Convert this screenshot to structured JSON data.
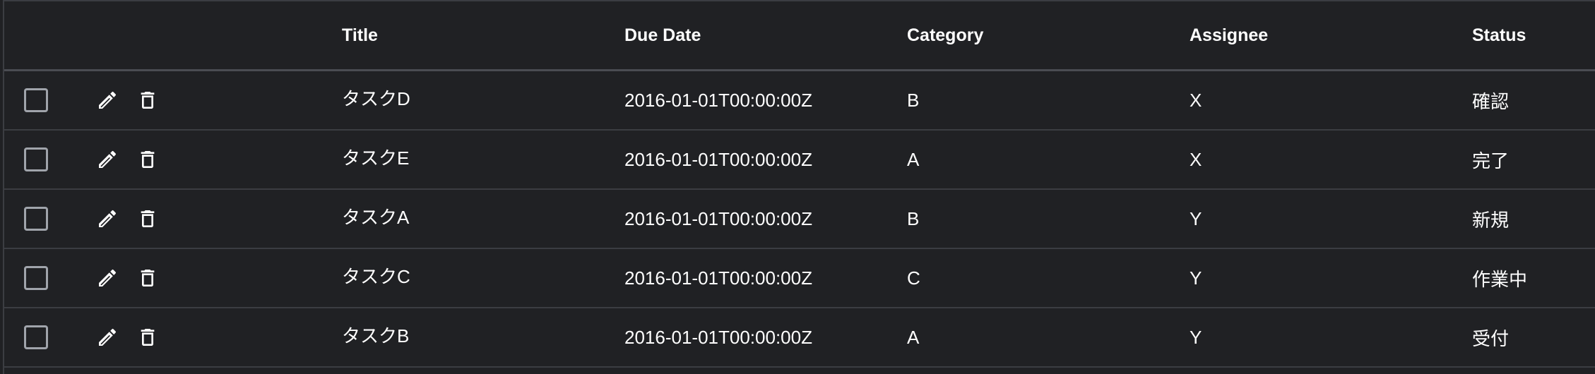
{
  "columns": {
    "title": "Title",
    "due_date": "Due Date",
    "category": "Category",
    "assignee": "Assignee",
    "status": "Status"
  },
  "rows": [
    {
      "title": "タスクD",
      "due_date": "2016-01-01T00:00:00Z",
      "category": "B",
      "assignee": "X",
      "status": "確認"
    },
    {
      "title": "タスクE",
      "due_date": "2016-01-01T00:00:00Z",
      "category": "A",
      "assignee": "X",
      "status": "完了"
    },
    {
      "title": "タスクA",
      "due_date": "2016-01-01T00:00:00Z",
      "category": "B",
      "assignee": "Y",
      "status": "新規"
    },
    {
      "title": "タスクC",
      "due_date": "2016-01-01T00:00:00Z",
      "category": "C",
      "assignee": "Y",
      "status": "作業中"
    },
    {
      "title": "タスクB",
      "due_date": "2016-01-01T00:00:00Z",
      "category": "A",
      "assignee": "Y",
      "status": "受付"
    }
  ],
  "icons": {
    "edit": "pencil-icon",
    "delete": "trash-icon"
  },
  "colors": {
    "background": "#202124",
    "border": "#3b3d42",
    "checkbox": "#a0a4ab",
    "text": "#ffffff"
  }
}
